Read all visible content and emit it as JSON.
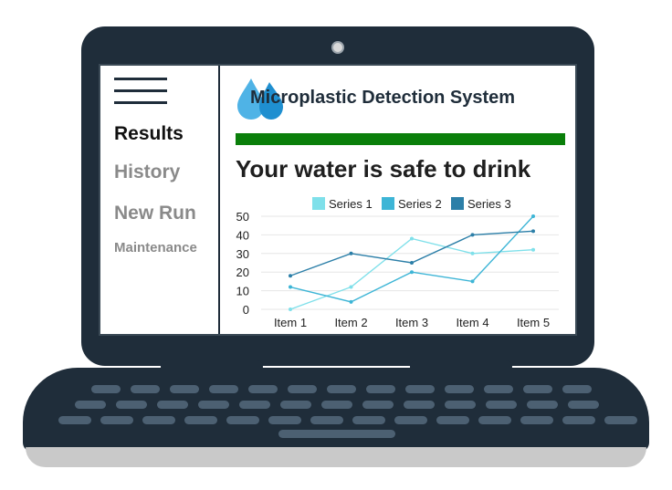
{
  "sidebar": {
    "items": [
      {
        "label": "Results",
        "color": "#111111"
      },
      {
        "label": "History",
        "color": "#8a8a8a"
      },
      {
        "label": "New Run",
        "color": "#8a8a8a"
      },
      {
        "label": "Maintenance",
        "color": "#8a8a8a"
      }
    ]
  },
  "header": {
    "title": "Microplastic Detection System",
    "logo_icon": "water-drops-icon"
  },
  "status": {
    "message": "Your water is safe to drink",
    "bar_color": "#0a7f0a"
  },
  "chart_data": {
    "type": "line",
    "categories": [
      "Item 1",
      "Item 2",
      "Item 3",
      "Item 4",
      "Item 5"
    ],
    "series": [
      {
        "name": "Series 1",
        "values": [
          0,
          12,
          38,
          30,
          32
        ],
        "color": "#7fe0ea"
      },
      {
        "name": "Series 2",
        "values": [
          12,
          4,
          20,
          15,
          50
        ],
        "color": "#3db5d6"
      },
      {
        "name": "Series 3",
        "values": [
          18,
          30,
          25,
          40,
          42
        ],
        "color": "#2c7fa8"
      }
    ],
    "ylim": [
      0,
      50
    ],
    "yticks": [
      "50",
      "40",
      "30",
      "20",
      "10",
      "0"
    ],
    "grid": true,
    "legend": "top"
  }
}
